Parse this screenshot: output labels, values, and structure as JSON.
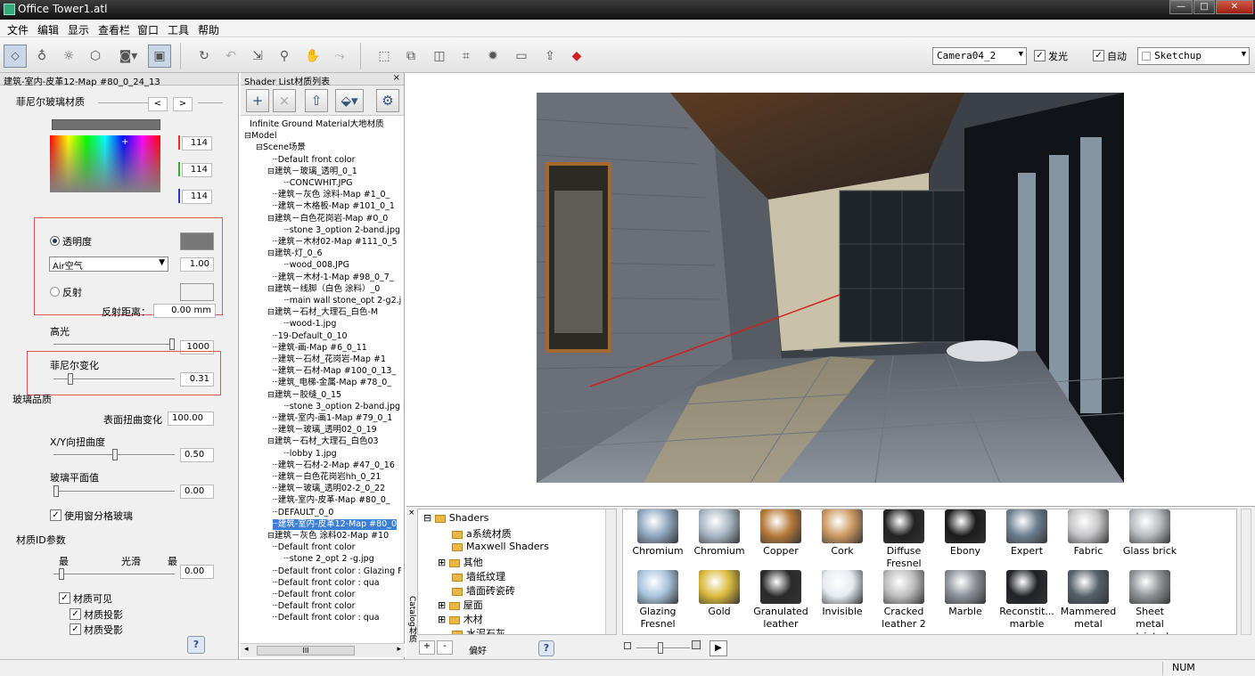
{
  "window": {
    "title": "Office Tower1.atl",
    "min": "—",
    "max": "□",
    "close": "✕"
  },
  "menu": [
    "文件",
    "编辑",
    "显示",
    "查看栏",
    "窗口",
    "工具",
    "帮助"
  ],
  "toolbar": {
    "camera_select": "Camera04_2",
    "glow_checked": true,
    "glow_label": "发光",
    "auto_checked": true,
    "auto_label": "自动",
    "engine_select": "Sketchup"
  },
  "material_panel": {
    "header": "建筑-室内-皮革12-Map #80_0_24_13",
    "title": "菲尼尔玻璃材质",
    "nav_prev": "<",
    "nav_next": ">",
    "rgb": [
      "114",
      "114",
      "114"
    ],
    "transparency_label": "透明度",
    "medium_select": "Air空气",
    "ior_value": "1.00",
    "reflect_label": "反射",
    "reflect_distance_label": "反射距离：",
    "reflect_distance_value": "0.00 mm",
    "highlight_label": "高光",
    "highlight_value": "1000",
    "fresnel_label": "菲尼尔变化",
    "fresnel_value": "0.31",
    "glass_quality_label": "玻璃品质",
    "surface_distortion_label": "表面扭曲变化",
    "surface_distortion_value": "100.00",
    "xy_distortion_label": "X/Y向扭曲度",
    "xy_distortion_value": "0.50",
    "flatness_label": "玻璃平面值",
    "flatness_value": "0.00",
    "use_window_glass_label": "使用窗分格玻璃",
    "id_params_label": "材质ID参数",
    "min_label": "最",
    "smooth_label": "光滑",
    "max_label": "最",
    "smooth_value": "0.00",
    "visible_label": "材质可见",
    "cast_shadow_label": "材质投影",
    "receive_shadow_label": "材质受影"
  },
  "shader_list": {
    "header": "Shader List材质列表",
    "items": [
      "Infinite Ground Material大地材质",
      "Model",
      "Scene场景",
      "Default front color",
      "建筑－玻璃_透明_0_1",
      "CONCWHIT.JPG",
      "建筑－灰色 涂料-Map #1_0_",
      "建筑－木格板-Map #101_0_1",
      "建筑－白色花岗岩-Map #0_0",
      "stone 3_option 2-band.jpg",
      "建筑－木材02-Map #111_0_5",
      "建筑-灯_0_6",
      "wood_008.JPG",
      "建筑－木材-1-Map #98_0_7_",
      "建筑－线脚（白色 涂料）_0",
      "main wall stone_opt 2-g2.jpg",
      "建筑－石材_大理石_白色-M",
      "wood-1.jpg",
      "19-Default_0_10",
      "建筑-画-Map #6_0_11",
      "建筑－石材_花岗岩-Map #1",
      "建筑－石材-Map #100_0_13_",
      "建筑_电梯-金属-Map #78_0_",
      "建筑－胶缝_0_15",
      "stone 3_option 2-band.jpg",
      "建筑-室内-画1-Map #79_0_1",
      "建筑－玻璃_透明02_0_19",
      "建筑－石材_大理石_白色03",
      "lobby 1.jpg",
      "建筑－石材-2-Map #47_0_16",
      "建筑－白色花岗岩hh_0_21",
      "建筑－玻璃_透明02-2_0_22",
      "建筑-室内-皮革-Map #80_0_",
      "DEFAULT_0_0",
      "建筑-室内-皮革12-Map #80_0",
      "建筑－灰色 涂料02-Map #10",
      "Default front color",
      "stone 2_opt 2 -g.jpg",
      "Default front color : Glazing Fre",
      "Default front color : qua",
      "Default front color",
      "Default front color",
      "Default front color : qua"
    ],
    "scroll_label": "III"
  },
  "catalog": {
    "side_label": "Catalog材质",
    "tree": [
      "Shaders",
      "a系统材质",
      "Maxwell Shaders",
      "其他",
      "墙纸纹理",
      "墙面砖瓷砖",
      "屋面",
      "木材",
      "水泥石灰"
    ],
    "favorites": "偏好",
    "row1": [
      "Chromium",
      "Chromium",
      "Copper",
      "Cork",
      "Diffuse Fresnel",
      "Ebony",
      "Expert",
      "Fabric",
      "Glass brick"
    ],
    "row2": [
      "Glazing Fresnel",
      "Gold",
      "Granulated leather",
      "Invisible",
      "Cracked leather 2",
      "Marble",
      "Reconstit... marble",
      "Mammered metal",
      "Sheet metal striated"
    ]
  },
  "status": {
    "num": "NUM"
  },
  "colors": {
    "selection": "#3b7fd6",
    "red_box": "#d55555",
    "toolbar_active": "#c9d7e6"
  }
}
